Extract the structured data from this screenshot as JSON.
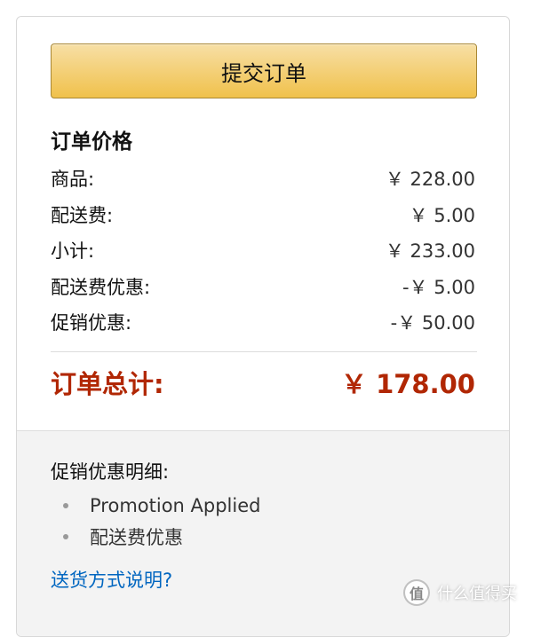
{
  "submit_button": {
    "label": "提交订单"
  },
  "order_price": {
    "title": "订单价格",
    "rows": [
      {
        "label": "商品:",
        "amount": "￥ 228.00"
      },
      {
        "label": "配送费:",
        "amount": "￥ 5.00"
      },
      {
        "label": "小计:",
        "amount": "￥ 233.00"
      },
      {
        "label": "配送费优惠:",
        "amount": "-￥ 5.00"
      },
      {
        "label": "促销优惠:",
        "amount": "-￥ 50.00"
      }
    ],
    "total": {
      "label": "订单总计:",
      "amount": "￥ 178.00"
    }
  },
  "promotions": {
    "title": "促销优惠明细:",
    "items": [
      "Promotion Applied",
      "配送费优惠"
    ]
  },
  "shipping_link": {
    "label": "送货方式说明?"
  },
  "watermark": {
    "text": "什么值得买",
    "logo_glyph": "值"
  },
  "colors": {
    "button_gradient_top": "#f7dfa5",
    "button_gradient_bottom": "#f0c14b",
    "total_red": "#b12704",
    "link_blue": "#0066c0",
    "bottom_bg": "#f3f3f3"
  }
}
